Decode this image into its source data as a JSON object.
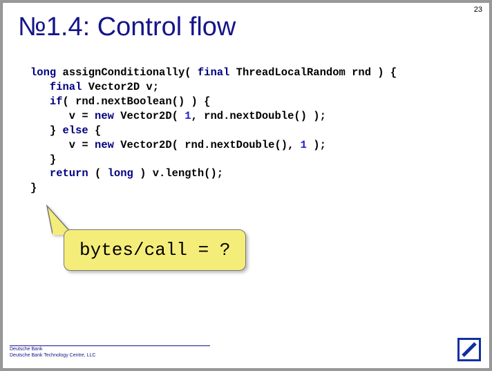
{
  "page_number": "23",
  "title": "№1.4: Control flow",
  "code": {
    "l1a": "long",
    "l1b": " assignConditionally( ",
    "l1c": "final",
    "l1d": " ThreadLocalRandom rnd ) {",
    "l2a": "   ",
    "l2b": "final",
    "l2c": " Vector2D v;",
    "l3a": "   ",
    "l3b": "if",
    "l3c": "( rnd.nextBoolean() ) {",
    "l4a": "      v = ",
    "l4b": "new",
    "l4c": " Vector2D( ",
    "l4d": "1",
    "l4e": ", rnd.nextDouble() );",
    "l5a": "   } ",
    "l5b": "else",
    "l5c": " {",
    "l6a": "      v = ",
    "l6b": "new",
    "l6c": " Vector2D( rnd.nextDouble(), ",
    "l6d": "1",
    "l6e": " );",
    "l7": "   }",
    "l8a": "   ",
    "l8b": "return",
    "l8c": " ( ",
    "l8d": "long",
    "l8e": " ) v.length();",
    "l9": "}"
  },
  "callout": "bytes/call = ?",
  "footer": {
    "line1": "Deutsche Bank",
    "line2": "Deutsche Bank Technology Centre, LLC"
  }
}
